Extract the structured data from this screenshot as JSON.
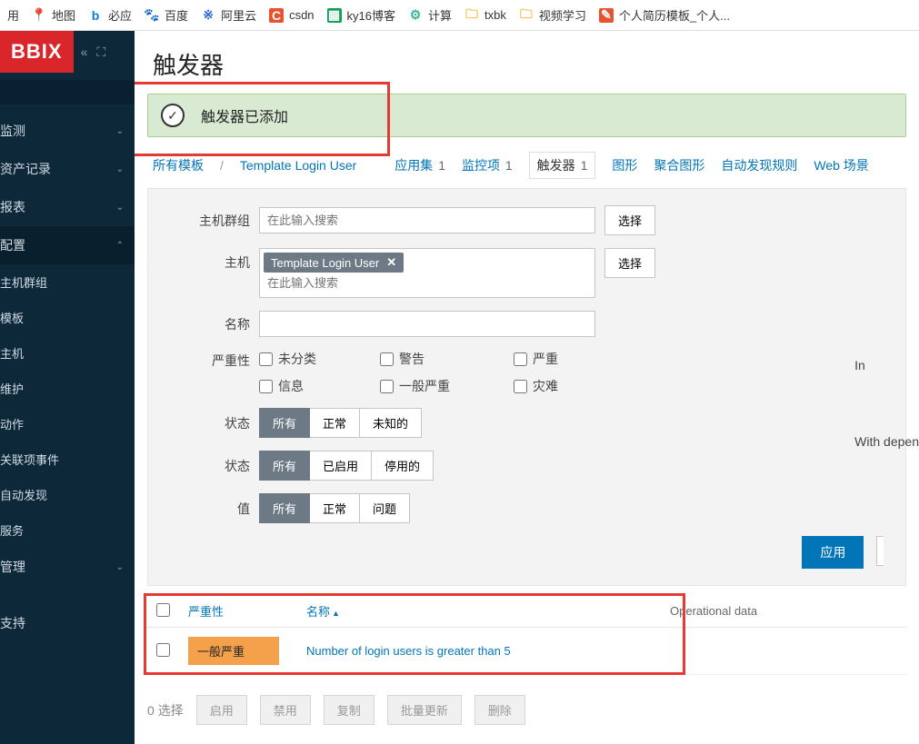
{
  "bookmarks": {
    "items": [
      {
        "label": "地图"
      },
      {
        "label": "必应"
      },
      {
        "label": "百度"
      },
      {
        "label": "阿里云"
      },
      {
        "label": "csdn"
      },
      {
        "label": "ky16博客"
      },
      {
        "label": "计算"
      },
      {
        "label": "txbk"
      },
      {
        "label": "视频学习"
      },
      {
        "label": "个人简历模板_个人..."
      }
    ],
    "first_label": "用"
  },
  "sidebar": {
    "logo": "BBIX",
    "search_placeholder": "",
    "nav": [
      {
        "label": "监测",
        "expandable": true,
        "open": false
      },
      {
        "label": "资产记录",
        "expandable": true,
        "open": false
      },
      {
        "label": "报表",
        "expandable": true,
        "open": false
      },
      {
        "label": "配置",
        "expandable": true,
        "open": true,
        "children": [
          {
            "label": "主机群组"
          },
          {
            "label": "模板"
          },
          {
            "label": "主机"
          },
          {
            "label": "维护"
          },
          {
            "label": "动作"
          },
          {
            "label": "关联项事件"
          },
          {
            "label": "自动发现"
          },
          {
            "label": "服务"
          }
        ]
      },
      {
        "label": "管理",
        "expandable": true,
        "open": false
      },
      {
        "label": "支持",
        "expandable": false
      }
    ]
  },
  "page": {
    "title": "触发器",
    "success_msg": "触发器已添加"
  },
  "breadcrumb": {
    "all_templates": "所有模板",
    "template_name": "Template Login User",
    "tabs": [
      {
        "label": "应用集",
        "count": "1"
      },
      {
        "label": "监控项",
        "count": "1"
      },
      {
        "label": "触发器",
        "count": "1",
        "active": true
      },
      {
        "label": "图形"
      },
      {
        "label": "聚合图形"
      },
      {
        "label": "自动发现规则"
      },
      {
        "label": "Web 场景"
      }
    ]
  },
  "filter": {
    "host_group_label": "主机群组",
    "host_group_placeholder": "在此输入搜索",
    "host_label": "主机",
    "host_tag": "Template Login User",
    "host_placeholder": "在此输入搜索",
    "name_label": "名称",
    "severity_label": "严重性",
    "status1_label": "状态",
    "status2_label": "状态",
    "value_label": "值",
    "select_btn": "选择",
    "severities": {
      "col1": [
        "未分类",
        "信息"
      ],
      "col2": [
        "警告",
        "一般严重"
      ],
      "col3": [
        "严重",
        "灾难"
      ]
    },
    "status1_opts": [
      "所有",
      "正常",
      "未知的"
    ],
    "status2_opts": [
      "所有",
      "已启用",
      "停用的"
    ],
    "value_opts": [
      "所有",
      "正常",
      "问题"
    ],
    "apply_label": "应用",
    "side_labels": {
      "inherited": "In",
      "with_deps": "With depen"
    }
  },
  "table": {
    "hdr_severity": "严重性",
    "hdr_name": "名称",
    "hdr_opdata": "Operational data",
    "rows": [
      {
        "severity": "一般严重",
        "name": "Number of login users is greater than 5"
      }
    ]
  },
  "footer": {
    "count_prefix": "0",
    "count_label": "选择",
    "actions": [
      "启用",
      "禁用",
      "复制",
      "批量更新",
      "删除"
    ]
  }
}
